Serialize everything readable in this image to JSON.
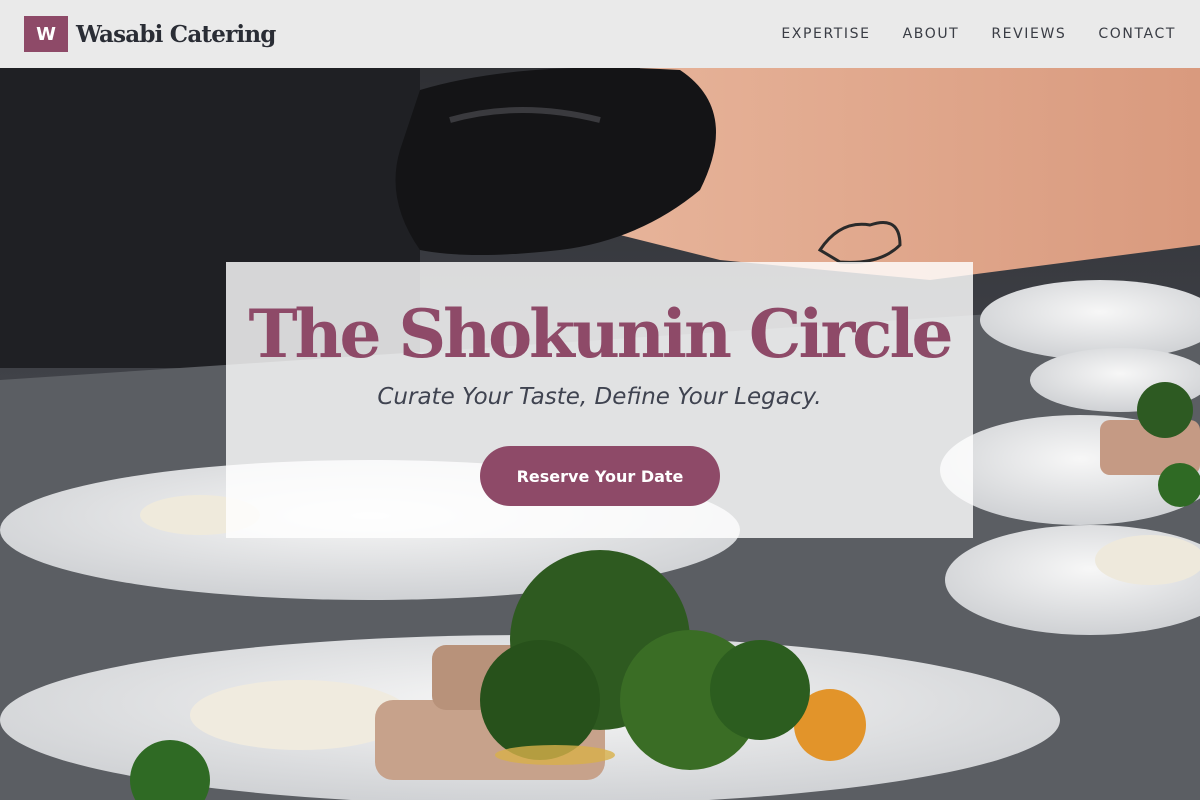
{
  "brand": {
    "logo_letter": "W",
    "name": "Wasabi Catering"
  },
  "nav": {
    "items": [
      "EXPERTISE",
      "ABOUT",
      "REVIEWS",
      "CONTACT"
    ]
  },
  "hero": {
    "title": "The Shokunin Circle",
    "subtitle": "Curate Your Taste, Define Your Legacy.",
    "cta_label": "Reserve Your Date"
  },
  "colors": {
    "accent": "#8e4a68",
    "header_bg": "#f4f4f4",
    "text_dark": "#2a2d35"
  }
}
